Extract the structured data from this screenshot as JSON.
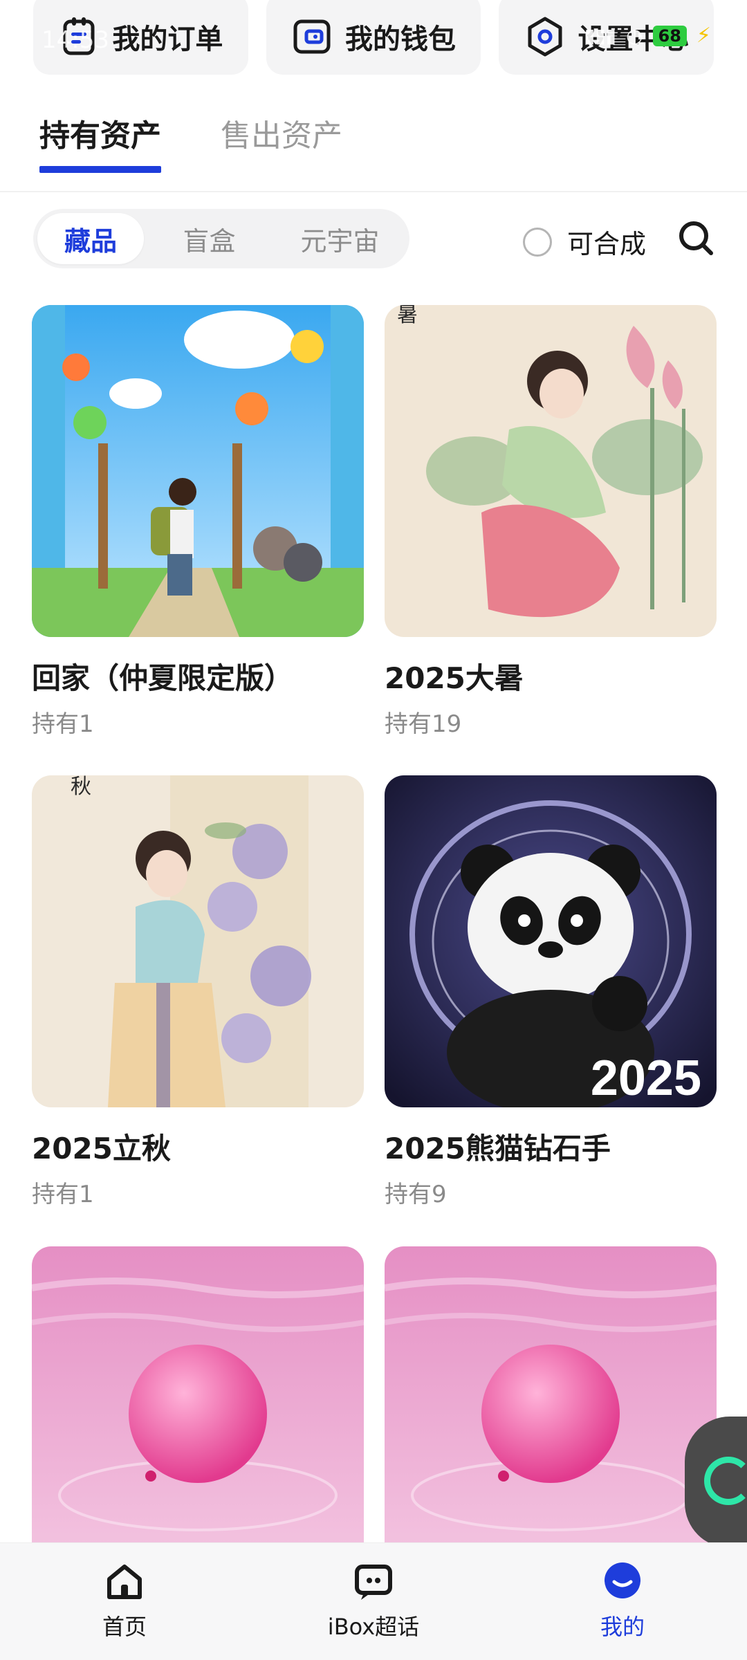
{
  "status": {
    "time": "14:53",
    "battery": "68"
  },
  "quick_actions": [
    {
      "label": "我的订单",
      "icon": "order-icon"
    },
    {
      "label": "我的钱包",
      "icon": "wallet-icon"
    },
    {
      "label": "设置中心",
      "icon": "settings-icon"
    }
  ],
  "tabs": [
    {
      "label": "持有资产",
      "active": true
    },
    {
      "label": "售出资产",
      "active": false
    }
  ],
  "segments": [
    {
      "label": "藏品",
      "active": true
    },
    {
      "label": "盲盒",
      "active": false
    },
    {
      "label": "元宇宙",
      "active": false
    }
  ],
  "filter": {
    "composable_label": "可合成"
  },
  "items": [
    {
      "title": "回家（仲夏限定版）",
      "owned": "持有1",
      "image": "cartoon boy with balloons"
    },
    {
      "title": "2025大暑",
      "owned": "持有19",
      "image": "ink painting lady with lotus",
      "seal_char": "暑"
    },
    {
      "title": "2025立秋",
      "owned": "持有1",
      "image": "ink painting lady with flowers",
      "seal_char": "秋"
    },
    {
      "title": "2025熊猫钻石手",
      "owned": "持有9",
      "image": "panda with light swirl",
      "badge": "2025"
    },
    {
      "title": "",
      "owned": "",
      "image": "pink balloon on water"
    },
    {
      "title": "",
      "owned": "",
      "image": "pink balloon on water"
    }
  ],
  "bottom_nav": [
    {
      "label": "首页",
      "icon": "home-icon",
      "active": false
    },
    {
      "label": "iBox超话",
      "icon": "chat-icon",
      "active": false
    },
    {
      "label": "我的",
      "icon": "profile-icon",
      "active": true
    }
  ],
  "colors": {
    "accent": "#1e3ddb",
    "muted": "#8a8a8a",
    "card_bg": "#f4f4f5"
  }
}
